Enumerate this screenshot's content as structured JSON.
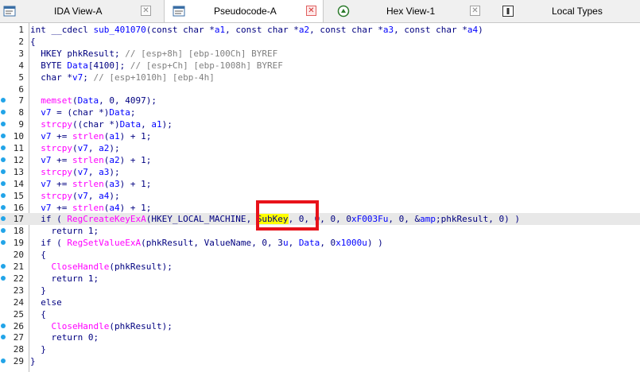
{
  "tabs": [
    {
      "label": "IDA View-A",
      "icon": "ida-view-icon",
      "active": false
    },
    {
      "label": "Pseudocode-A",
      "icon": "pseudocode-icon",
      "active": true
    },
    {
      "label": "Hex View-1",
      "icon": "hex-view-icon",
      "active": false
    },
    {
      "label": "Local Types",
      "icon": "local-types-icon",
      "active": false
    }
  ],
  "code_lines": [
    {
      "n": "1",
      "text": "int __cdecl sub_401070(const char *a1, const char *a2, const char *a3, const char *a4)",
      "dot": false
    },
    {
      "n": "2",
      "text": "{",
      "dot": false
    },
    {
      "n": "3",
      "text": "  HKEY phkResult; // [esp+8h] [ebp-100Ch] BYREF",
      "dot": false
    },
    {
      "n": "4",
      "text": "  BYTE Data[4100]; // [esp+Ch] [ebp-1008h] BYREF",
      "dot": false
    },
    {
      "n": "5",
      "text": "  char *v7; // [esp+1010h] [ebp-4h]",
      "dot": false
    },
    {
      "n": "6",
      "text": "",
      "dot": false
    },
    {
      "n": "7",
      "text": "  memset(Data, 0, 4097);",
      "dot": true
    },
    {
      "n": "8",
      "text": "  v7 = (char *)Data;",
      "dot": true
    },
    {
      "n": "9",
      "text": "  strcpy((char *)Data, a1);",
      "dot": true
    },
    {
      "n": "10",
      "text": "  v7 += strlen(a1) + 1;",
      "dot": true
    },
    {
      "n": "11",
      "text": "  strcpy(v7, a2);",
      "dot": true
    },
    {
      "n": "12",
      "text": "  v7 += strlen(a2) + 1;",
      "dot": true
    },
    {
      "n": "13",
      "text": "  strcpy(v7, a3);",
      "dot": true
    },
    {
      "n": "14",
      "text": "  v7 += strlen(a3) + 1;",
      "dot": true
    },
    {
      "n": "15",
      "text": "  strcpy(v7, a4);",
      "dot": true
    },
    {
      "n": "16",
      "text": "  v7 += strlen(a4) + 1;",
      "dot": true
    },
    {
      "n": "17",
      "text": "  if ( RegCreateKeyExA(HKEY_LOCAL_MACHINE, SubKey, 0, 0, 0, 0xF003Fu, 0, &phkResult, 0) )",
      "dot": true
    },
    {
      "n": "18",
      "text": "    return 1;",
      "dot": true
    },
    {
      "n": "19",
      "text": "  if ( RegSetValueExA(phkResult, ValueName, 0, 3u, Data, 0x1000u) )",
      "dot": true
    },
    {
      "n": "20",
      "text": "  {",
      "dot": false
    },
    {
      "n": "21",
      "text": "    CloseHandle(phkResult);",
      "dot": true
    },
    {
      "n": "22",
      "text": "    return 1;",
      "dot": true
    },
    {
      "n": "23",
      "text": "  }",
      "dot": false
    },
    {
      "n": "24",
      "text": "  else",
      "dot": false
    },
    {
      "n": "25",
      "text": "  {",
      "dot": false
    },
    {
      "n": "26",
      "text": "    CloseHandle(phkResult);",
      "dot": true
    },
    {
      "n": "27",
      "text": "    return 0;",
      "dot": true
    },
    {
      "n": "28",
      "text": "  }",
      "dot": false
    },
    {
      "n": "29",
      "text": "}",
      "dot": true
    }
  ],
  "highlight": {
    "word": "SubKey",
    "current_line": "17"
  },
  "colors": {
    "accent_dot": "#22a4e8",
    "annotation_box": "#e8121a",
    "highlight": "#ffff00"
  }
}
